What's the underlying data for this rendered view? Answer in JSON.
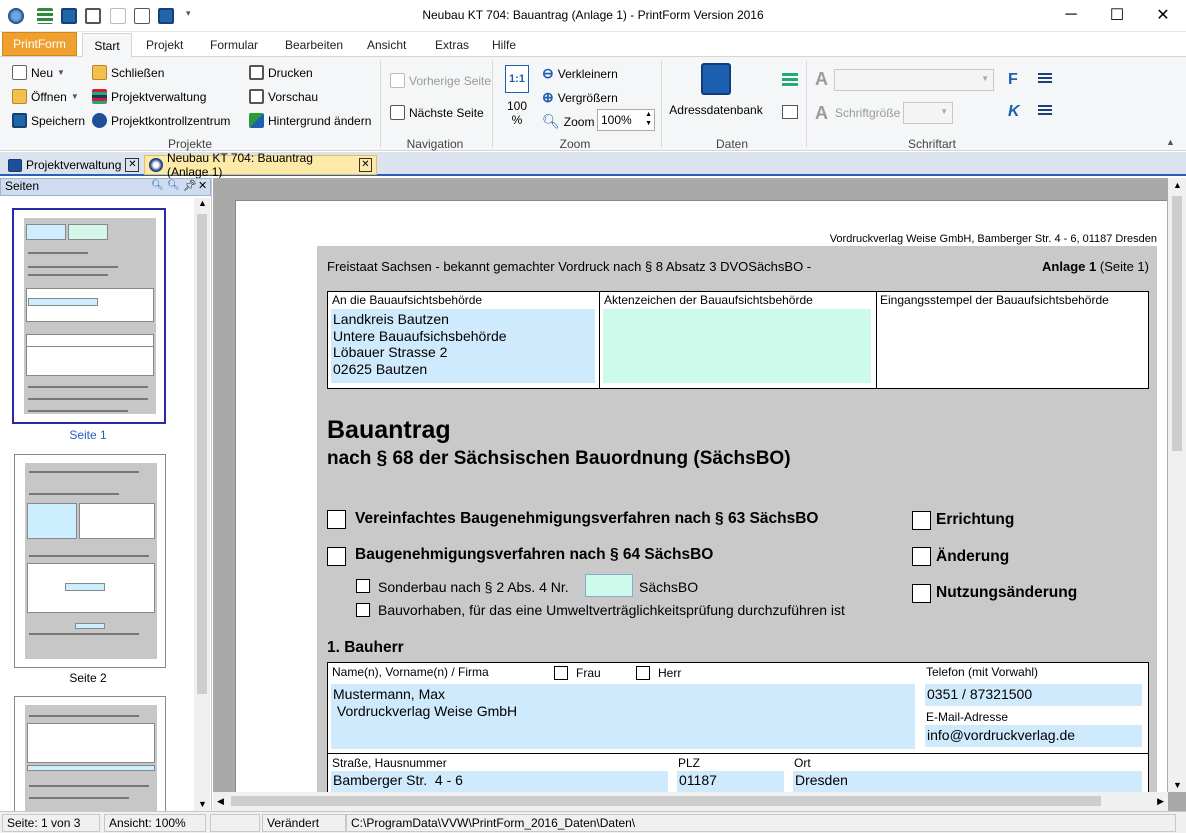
{
  "window": {
    "title": "Neubau KT 704: Bauantrag (Anlage 1) - PrintForm Version 2016",
    "controls": {
      "minimize": "─",
      "maximize": "☐",
      "close": "✕"
    }
  },
  "ribbon_tabs": {
    "app_tab": "PrintForm",
    "tabs": [
      "Start",
      "Projekt",
      "Formular",
      "Bearbeiten",
      "Ansicht",
      "Extras",
      "Hilfe"
    ]
  },
  "ribbon": {
    "projekte": {
      "label": "Projekte",
      "neu": "Neu",
      "oeffnen": "Öffnen",
      "speichern": "Speichern",
      "schliessen": "Schließen",
      "projektverwaltung": "Projektverwaltung",
      "projektkontrollzentrum": "Projektkontrollzentrum",
      "drucken": "Drucken",
      "vorschau": "Vorschau",
      "hintergrund": "Hintergrund ändern"
    },
    "navigation": {
      "label": "Navigation",
      "vorherige": "Vorherige Seite",
      "naechste": "Nächste Seite"
    },
    "zoom": {
      "label": "Zoom",
      "ratio_icon": "1:1",
      "hundred_top": "100",
      "hundred_bottom": "%",
      "verkleinern": "Verkleinern",
      "vergroessern": "Vergrößern",
      "zoom_label": "Zoom",
      "zoom_value": "100%"
    },
    "daten": {
      "label": "Daten",
      "adressdatenbank": "Adressdatenbank"
    },
    "schriftart": {
      "label": "Schriftart",
      "font_letter": "A",
      "size_letter": "A",
      "schriftgroesse": "Schriftgröße",
      "bold": "F",
      "italic": "K"
    }
  },
  "doc_tabs": {
    "projektverwaltung": "Projektverwaltung",
    "bauantrag": "Neubau KT 704: Bauantrag (Anlage 1)"
  },
  "pages_pane": {
    "title": "Seiten",
    "pages": [
      "Seite 1",
      "Seite 2"
    ]
  },
  "form": {
    "publisher": "Vordruckverlag Weise GmbH, Bamberger Str. 4 - 6, 01187 Dresden",
    "header_left": "Freistaat Sachsen - bekannt gemachter Vordruck nach § 8 Absatz 3 DVOSächsBO -",
    "anlage": "Anlage 1",
    "seite": "(Seite 1)",
    "behoerde_label": "An die Bauaufsichtsbehörde",
    "behoerde_lines": [
      "Landkreis Bautzen",
      "Untere Bauaufsichsbehörde",
      "Löbauer Strasse 2",
      "02625 Bautzen"
    ],
    "aktenzeichen_label": "Aktenzeichen der Bauaufsichtsbehörde",
    "eingangsstempel_label": "Eingangsstempel der Bauaufsichtsbehörde",
    "title": "Bauantrag",
    "subtitle": "nach § 68 der Sächsischen Bauordnung (SächsBO)",
    "opt_vereinfacht": "Vereinfachtes Baugenehmigungsverfahren nach § 63 SächsBO",
    "opt_baugen": "Baugenehmigungsverfahren nach § 64 SächsBO",
    "opt_sonderbau": "Sonderbau nach § 2 Abs. 4 Nr.",
    "opt_sonderbau_suffix": "SächsBO",
    "opt_uvp": "Bauvorhaben, für das eine Umweltverträglichkeitsprüfung durchzuführen ist",
    "opt_errichtung": "Errichtung",
    "opt_aenderung": "Änderung",
    "opt_nutzung": "Nutzungsänderung",
    "section_bauherr": "1. Bauherr",
    "name_label": "Name(n), Vorname(n) / Firma",
    "frau": "Frau",
    "herr": "Herr",
    "name_line1": "Mustermann, Max",
    "name_line2": " Vordruckverlag Weise GmbH",
    "telefon_label": "Telefon (mit Vorwahl)",
    "telefon_value": "0351 / 87321500",
    "email_label": "E-Mail-Adresse",
    "email_value": "info@vordruckverlag.de",
    "strasse_label": "Straße, Hausnummer",
    "strasse_value": "Bamberger Str.  4 - 6",
    "plz_label": "PLZ",
    "plz_value": "01187",
    "ort_label": "Ort",
    "ort_value": "Dresden"
  },
  "statusbar": {
    "seite": "Seite: 1 von 3",
    "ansicht": "Ansicht: 100%",
    "status": "Verändert",
    "path": "C:\\ProgramData\\VVW\\PrintForm_2016_Daten\\Daten\\"
  },
  "colors": {
    "accent": "#2c5fb4",
    "app_tab": "#f0a030",
    "field_blue": "#cfeafc",
    "field_green": "#cefaec",
    "form_gray": "#c9c9c9"
  }
}
